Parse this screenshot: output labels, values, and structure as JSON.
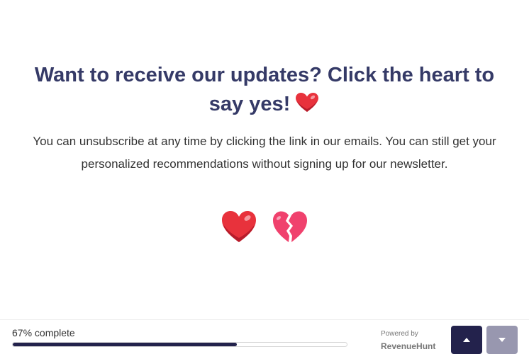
{
  "question": {
    "title": "Want to receive our updates? Click the heart to say yes!",
    "description": "You can unsubscribe at any time by clicking the link in our emails. You can still get your personalized recommendations without signing up for our newsletter."
  },
  "choices": [
    {
      "icon": "red-heart-icon"
    },
    {
      "icon": "broken-heart-icon"
    }
  ],
  "footer": {
    "progress_label": "67% complete",
    "progress_fraction": 0.67,
    "powered_by": "Powered by",
    "brand": "RevenueHunt"
  },
  "colors": {
    "title": "#353a67",
    "accent": "#23224c",
    "nav_disabled": "#9897af",
    "heart_red": "#e8323c",
    "heart_pink": "#f0416d"
  }
}
